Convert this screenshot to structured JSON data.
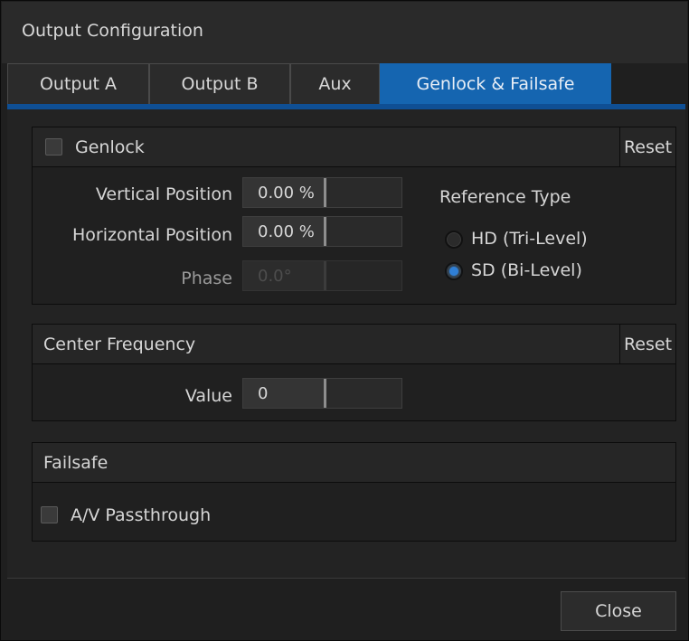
{
  "window": {
    "title": "Output Configuration"
  },
  "tabs": [
    {
      "label": "Output A",
      "active": false
    },
    {
      "label": "Output B",
      "active": false
    },
    {
      "label": "Aux",
      "active": false
    },
    {
      "label": "Genlock & Failsafe",
      "active": true
    }
  ],
  "genlock": {
    "title": "Genlock",
    "checked": false,
    "reset_label": "Reset",
    "vertical_position": {
      "label": "Vertical Position",
      "value": "0.00 %"
    },
    "horizontal_position": {
      "label": "Horizontal Position",
      "value": "0.00 %"
    },
    "phase": {
      "label": "Phase",
      "value": "0.0°",
      "disabled": true
    },
    "reference_type": {
      "label": "Reference Type",
      "options": [
        {
          "label": "HD (Tri-Level)",
          "selected": false
        },
        {
          "label": "SD (Bi-Level)",
          "selected": true
        }
      ]
    }
  },
  "center_frequency": {
    "title": "Center Frequency",
    "reset_label": "Reset",
    "value_field": {
      "label": "Value",
      "value": "0"
    }
  },
  "failsafe": {
    "title": "Failsafe",
    "av_passthrough": {
      "label": "A/V Passthrough",
      "checked": false
    }
  },
  "footer": {
    "close_label": "Close"
  },
  "colors": {
    "accent": "#1565b0",
    "background": "#1f1f1f",
    "panel": "#202020"
  }
}
